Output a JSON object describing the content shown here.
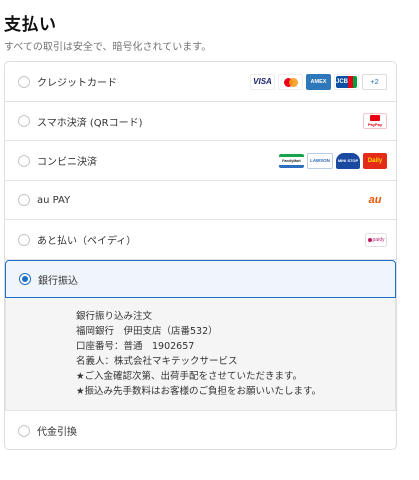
{
  "header": {
    "title": "支払い",
    "subtitle": "すべての取引は安全で、暗号化されています。"
  },
  "payment_methods": [
    {
      "label": "クレジットカード",
      "selected": false,
      "logos": [
        {
          "name": "visa-logo",
          "text": "VISA"
        },
        {
          "name": "mastercard-logo",
          "text": ""
        },
        {
          "name": "amex-logo",
          "text": "AMEX"
        },
        {
          "name": "jcb-logo",
          "text": "JCB"
        },
        {
          "name": "more-cards-badge",
          "text": "+2"
        }
      ]
    },
    {
      "label": "スマホ決済 (QRコード)",
      "selected": false,
      "logos": [
        {
          "name": "paypay-logo",
          "text": "PayPay"
        }
      ]
    },
    {
      "label": "コンビニ決済",
      "selected": false,
      "logos": [
        {
          "name": "familymart-logo",
          "text": "FamilyMart"
        },
        {
          "name": "lawson-logo",
          "text": "LAWSON"
        },
        {
          "name": "ministop-logo",
          "text": "MINI STOP"
        },
        {
          "name": "daily-yamazaki-logo",
          "text": "Daily"
        }
      ]
    },
    {
      "label": "au PAY",
      "selected": false,
      "logos": [
        {
          "name": "au-logo",
          "text": "au"
        }
      ]
    },
    {
      "label": "あと払い（ペイディ）",
      "selected": false,
      "logos": [
        {
          "name": "paidy-logo",
          "text": "paidy"
        }
      ]
    },
    {
      "label": "銀行振込",
      "selected": true,
      "logos": []
    },
    {
      "label": "代金引換",
      "selected": false,
      "logos": []
    }
  ],
  "bank_transfer_instructions": [
    "銀行振り込み注文",
    "福岡銀行　伊田支店（店番532）",
    "口座番号：普通　1902657",
    "名義人：株式会社マキテックサービス",
    "★ご入金確認次第、出荷手配をさせていただきます。",
    "★振込み先手数料はお客様のご負担をお願いいたします。"
  ],
  "colors": {
    "accent": "#1c6fc4",
    "selected_row_bg": "#f0f5fb",
    "instructions_bg": "#f5f5f5",
    "border": "#dedede"
  }
}
